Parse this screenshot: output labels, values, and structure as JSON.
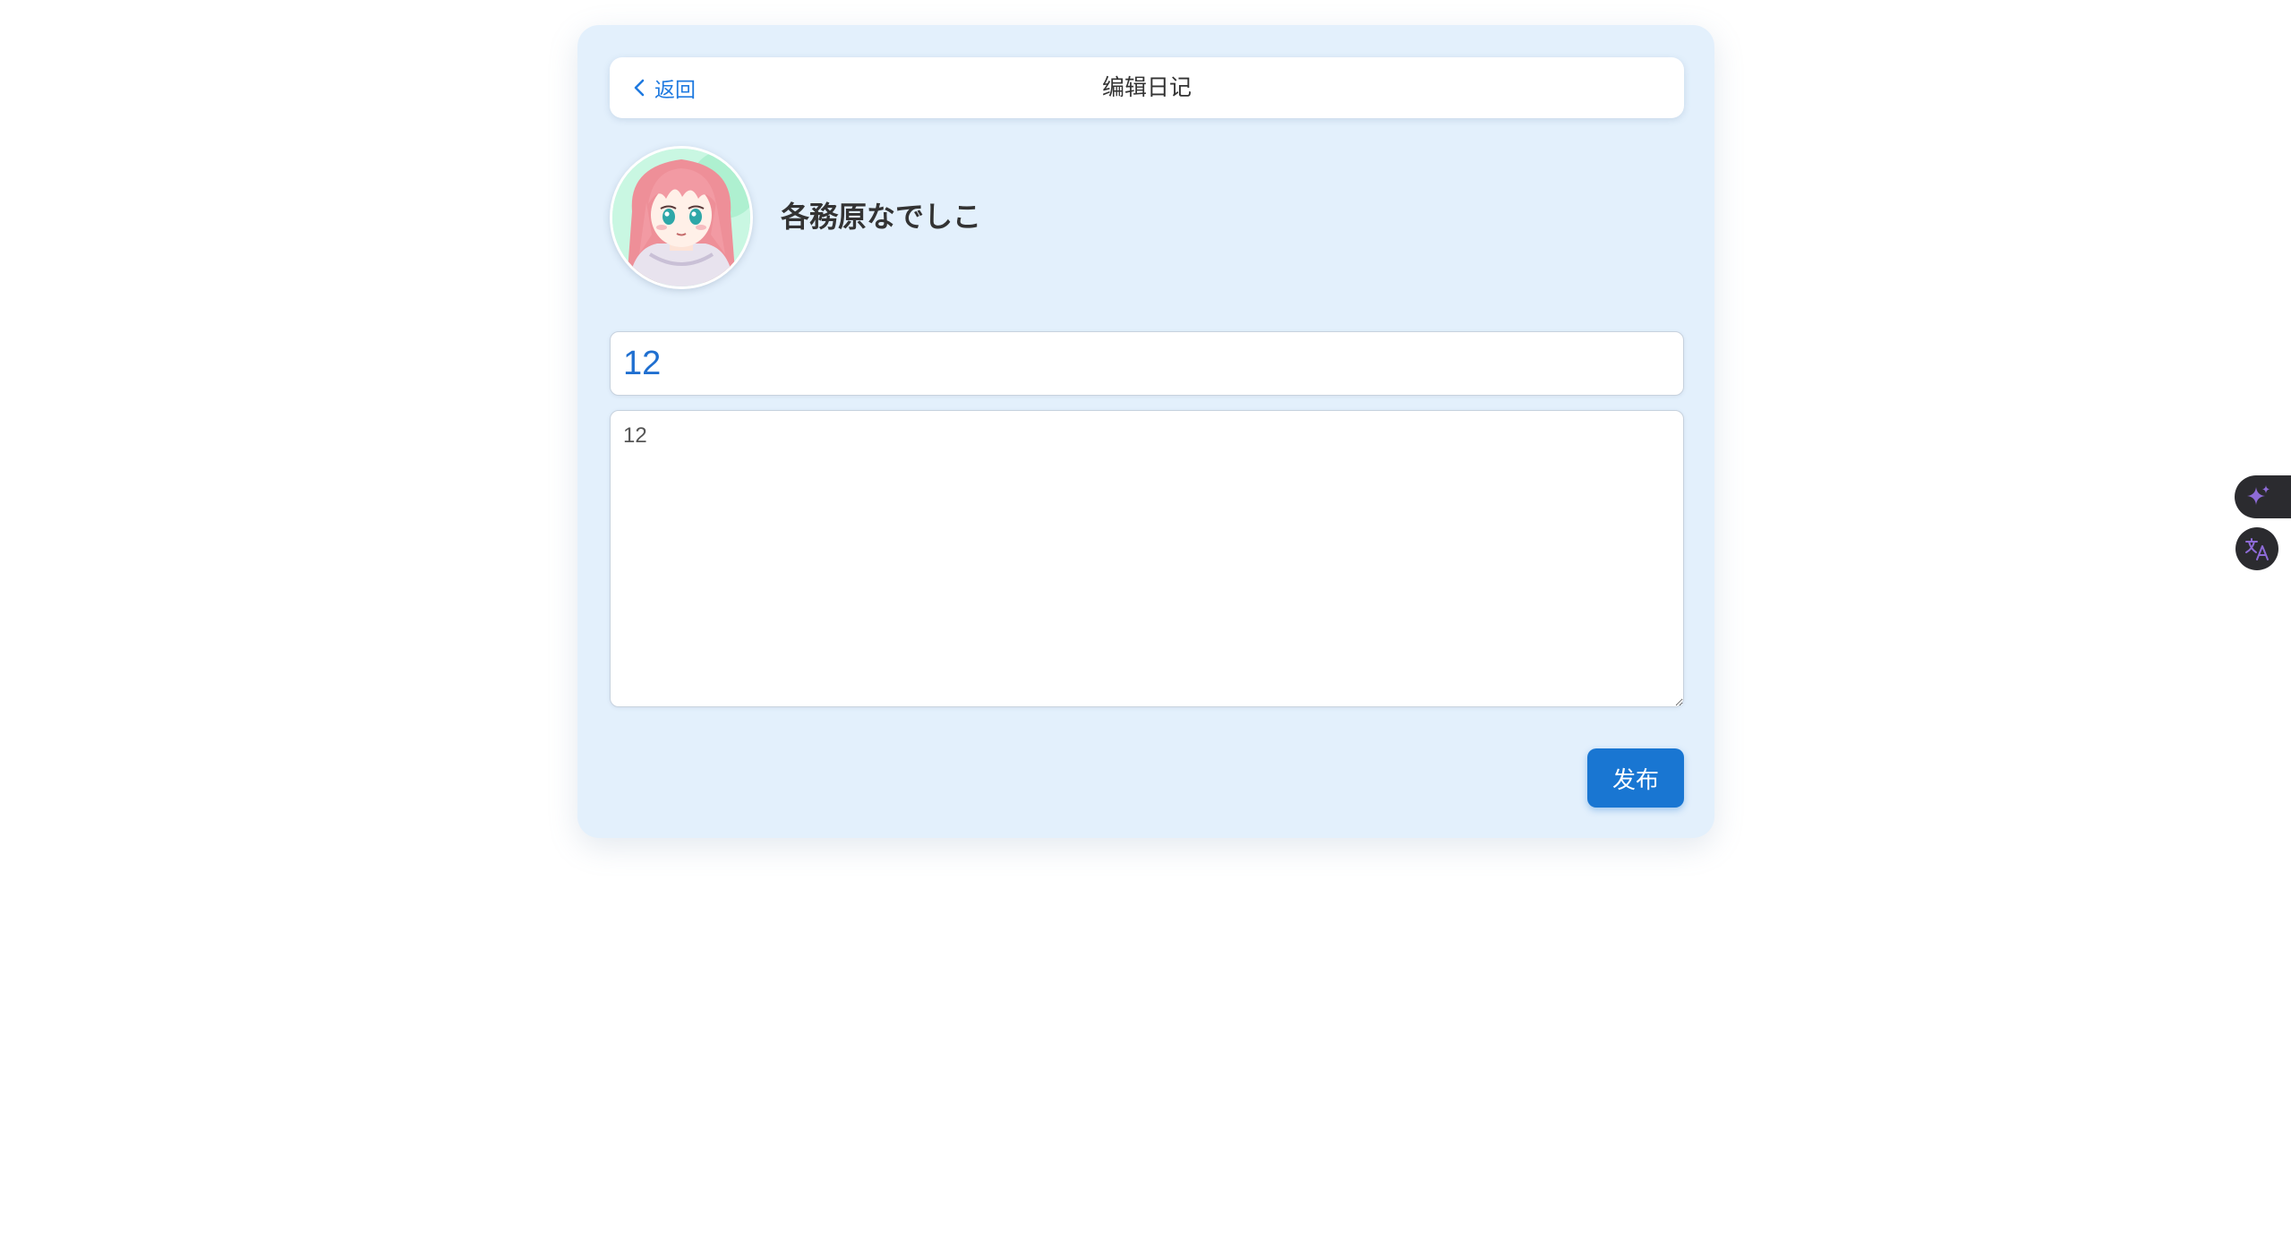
{
  "header": {
    "back_label": "返回",
    "title": "编辑日记"
  },
  "profile": {
    "username": "各務原なでしこ",
    "avatar": "anime-girl-avatar"
  },
  "form": {
    "title_value": "12",
    "content_value": "12"
  },
  "actions": {
    "publish_label": "发布"
  },
  "floating_tools": {
    "ai_icon": "sparkle-icon",
    "translate_icon": "translate-icon"
  },
  "colors": {
    "card_background": "#e3f0fc",
    "accent": "#1976d2",
    "link": "#1f7ae0",
    "float_bg": "#2b2b2f",
    "float_icon": "#8e6bd8"
  }
}
